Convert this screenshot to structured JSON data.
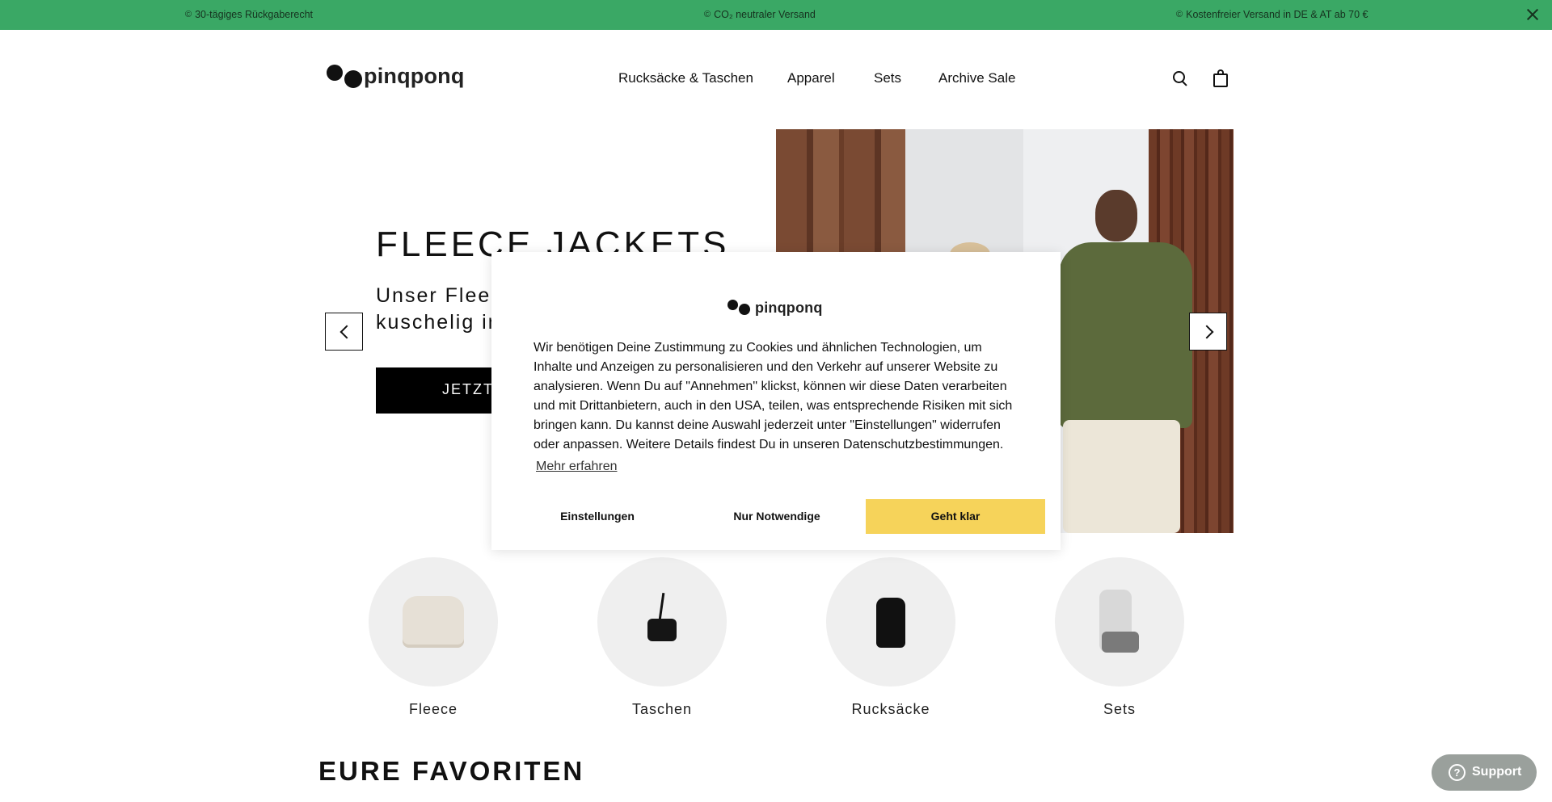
{
  "announcement": {
    "items": [
      {
        "icon": "©",
        "text": "30-tägiges Rückgaberecht"
      },
      {
        "icon": "©",
        "text": "CO₂ neutraler Versand"
      },
      {
        "icon": "©",
        "text": "Kostenfreier Versand in DE & AT ab 70 €"
      }
    ]
  },
  "header": {
    "logo_text": "pinqponq",
    "nav": [
      "Rucksäcke & Taschen",
      "Apparel",
      "Sets",
      "Archive Sale"
    ],
    "icons": [
      "search-icon",
      "cart-icon"
    ]
  },
  "hero": {
    "title": "FLEECE JACKETS",
    "subtitle_line1": "Unser Fleece",
    "subtitle_line2": "kuschelig in",
    "button": "JETZT"
  },
  "categories": [
    {
      "label": "Fleece"
    },
    {
      "label": "Taschen"
    },
    {
      "label": "Rucksäcke"
    },
    {
      "label": "Sets"
    }
  ],
  "favorites_title": "EURE FAVORITEN",
  "cookie": {
    "logo_text": "pinqponq",
    "text": "Wir benötigen Deine Zustimmung zu Cookies und ähnlichen Technologien, um Inhalte und Anzeigen zu personalisieren und den Verkehr auf unserer Website zu analysieren. Wenn Du auf \"Annehmen\" klickst, können wir diese Daten verarbeiten und mit Drittanbietern, auch in den USA, teilen, was entsprechende Risiken mit sich bringen kann. Du kannst deine Auswahl jederzeit unter \"Einstellungen\" widerrufen oder anpassen. Weitere Details findest Du in unseren Datenschutzbestimmungen.",
    "link": "Mehr erfahren",
    "buttons": {
      "settings": "Einstellungen",
      "necessary": "Nur Notwendige",
      "accept": "Geht klar"
    }
  },
  "support": {
    "label": "Support",
    "icon": "?"
  },
  "colors": {
    "topbar": "#3aa865",
    "accept_button": "#f6d35a",
    "support_button": "#9aa09c"
  }
}
